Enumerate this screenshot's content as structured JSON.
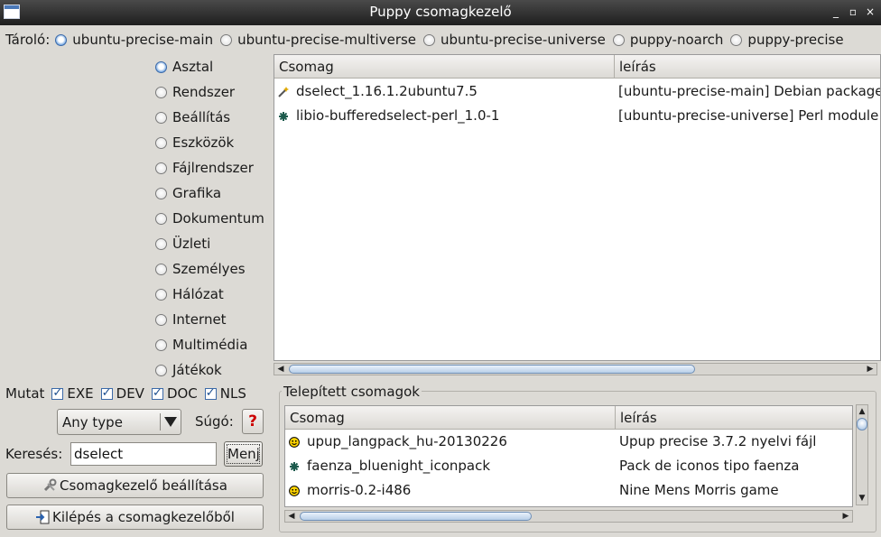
{
  "window": {
    "title": "Puppy csomagkezelő",
    "controls": [
      "_",
      "▫",
      "×"
    ]
  },
  "repo": {
    "label": "Tároló:",
    "options": [
      {
        "label": "ubuntu-precise-main",
        "selected": true
      },
      {
        "label": "ubuntu-precise-multiverse",
        "selected": false
      },
      {
        "label": "ubuntu-precise-universe",
        "selected": false
      },
      {
        "label": "puppy-noarch",
        "selected": false
      },
      {
        "label": "puppy-precise",
        "selected": false
      }
    ]
  },
  "categories": [
    {
      "label": "Asztal",
      "selected": true
    },
    {
      "label": "Rendszer",
      "selected": false
    },
    {
      "label": "Beállítás",
      "selected": false
    },
    {
      "label": "Eszközök",
      "selected": false
    },
    {
      "label": "Fájlrendszer",
      "selected": false
    },
    {
      "label": "Grafika",
      "selected": false
    },
    {
      "label": "Dokumentum",
      "selected": false
    },
    {
      "label": "Üzleti",
      "selected": false
    },
    {
      "label": "Személyes",
      "selected": false
    },
    {
      "label": "Hálózat",
      "selected": false
    },
    {
      "label": "Internet",
      "selected": false
    },
    {
      "label": "Multimédia",
      "selected": false
    },
    {
      "label": "Játékok",
      "selected": false
    }
  ],
  "packages": {
    "columns": [
      "Csomag",
      "leírás"
    ],
    "rows": [
      {
        "icon": "wand-icon",
        "name": "dselect_1.16.1.2ubuntu7.5",
        "desc": "[ubuntu-precise-main] Debian package"
      },
      {
        "icon": "star-icon",
        "name": "libio-bufferedselect-perl_1.0-1",
        "desc": "[ubuntu-precise-universe] Perl module"
      }
    ],
    "scroll_fraction": 0.7
  },
  "show": {
    "label": "Mutat",
    "options": [
      {
        "label": "EXE",
        "checked": true
      },
      {
        "label": "DEV",
        "checked": true
      },
      {
        "label": "DOC",
        "checked": true
      },
      {
        "label": "NLS",
        "checked": true
      }
    ]
  },
  "type_combo": {
    "value": "Any type"
  },
  "help": {
    "label": "Súgó:",
    "icon": "question-icon"
  },
  "search": {
    "label": "Keresés:",
    "value": "dselect",
    "button": "Menj"
  },
  "buttons": {
    "settings": "Csomagkezelő beállítása",
    "exit": "Kilépés a csomagkezelőből"
  },
  "installed": {
    "title": "Telepített csomagok",
    "columns": [
      "Csomag",
      "leírás"
    ],
    "rows": [
      {
        "icon": "smiley-icon",
        "name": "upup_langpack_hu-20130226",
        "desc": "Upup precise 3.7.2 nyelvi fájl"
      },
      {
        "icon": "star-icon",
        "name": "faenza_bluenight_iconpack",
        "desc": "Pack de iconos tipo faenza"
      },
      {
        "icon": "smiley-icon",
        "name": "morris-0.2-i486",
        "desc": "Nine Mens Morris game"
      }
    ]
  },
  "colors": {
    "background": "#dcdad5",
    "titlebar": "#2a2a2a",
    "accent": "#3c6aa8",
    "help_icon": "#cc0000"
  }
}
